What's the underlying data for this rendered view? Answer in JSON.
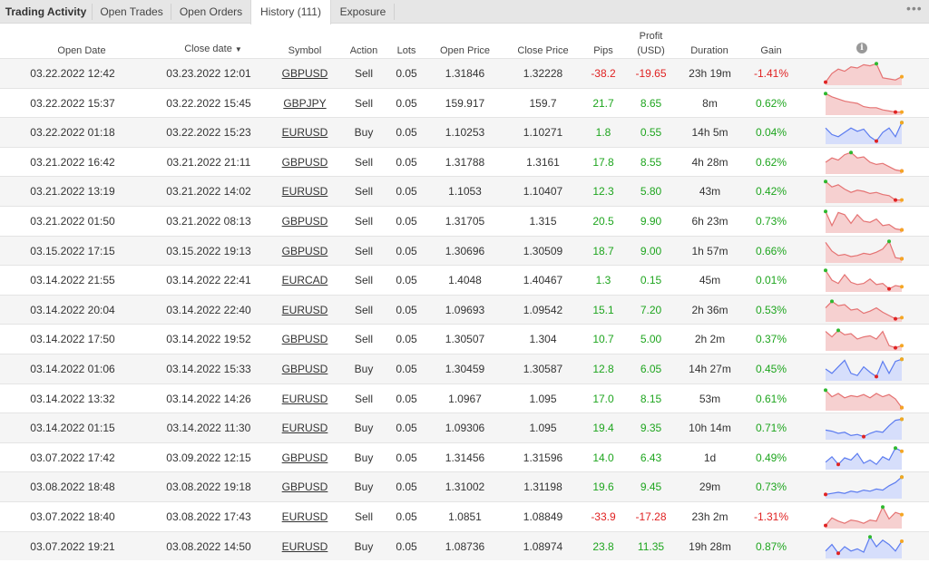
{
  "tabs": [
    {
      "label": "Trading Activity",
      "left": 0
    },
    {
      "label": "Open Trades"
    },
    {
      "label": "Open Orders"
    },
    {
      "label": "History (111)"
    },
    {
      "label": "Exposure"
    }
  ],
  "active_tab": "History (111)",
  "headers": {
    "open_date": "Open Date",
    "close_date": "Close date",
    "symbol": "Symbol",
    "action": "Action",
    "lots": "Lots",
    "open_price": "Open Price",
    "close_price": "Close Price",
    "pips": "Pips",
    "profit_line1": "Profit",
    "profit_line2": "(USD)",
    "duration": "Duration",
    "gain": "Gain"
  },
  "colors": {
    "positive": "#1ea51e",
    "negative": "#e02222",
    "sell_line": "#e57373",
    "sell_fill": "#f6d0d0",
    "buy_line": "#5c7cf0",
    "buy_fill": "#d6defb"
  },
  "icons": {
    "more": "more-dots-icon",
    "info": "info-icon"
  },
  "trades": [
    {
      "open_date": "03.22.2022 12:42",
      "close_date": "03.23.2022 12:01",
      "symbol": "GBPUSD",
      "action": "Sell",
      "lots": "0.05",
      "open_price": "1.31846",
      "close_price": "1.32228",
      "pips": "-38.2",
      "profit": "-19.65",
      "duration": "23h 19m",
      "gain": "-1.41%",
      "spark": [
        0.1,
        0.5,
        0.7,
        0.6,
        0.8,
        0.75,
        0.9,
        0.85,
        0.95,
        0.3,
        0.25,
        0.2,
        0.35
      ]
    },
    {
      "open_date": "03.22.2022 15:37",
      "close_date": "03.22.2022 15:45",
      "symbol": "GBPJPY",
      "action": "Sell",
      "lots": "0.05",
      "open_price": "159.917",
      "close_price": "159.7",
      "pips": "21.7",
      "profit": "8.65",
      "duration": "8m",
      "gain": "0.62%",
      "spark": [
        0.95,
        0.8,
        0.7,
        0.6,
        0.55,
        0.5,
        0.35,
        0.3,
        0.3,
        0.2,
        0.15,
        0.1,
        0.1
      ]
    },
    {
      "open_date": "03.22.2022 01:18",
      "close_date": "03.22.2022 15:23",
      "symbol": "EURUSD",
      "action": "Buy",
      "lots": "0.05",
      "open_price": "1.10253",
      "close_price": "1.10271",
      "pips": "1.8",
      "profit": "0.55",
      "duration": "14h 5m",
      "gain": "0.04%",
      "spark": [
        0.7,
        0.4,
        0.3,
        0.5,
        0.7,
        0.55,
        0.65,
        0.3,
        0.1,
        0.5,
        0.7,
        0.3,
        0.95
      ]
    },
    {
      "open_date": "03.21.2022 16:42",
      "close_date": "03.21.2022 21:11",
      "symbol": "GBPUSD",
      "action": "Sell",
      "lots": "0.05",
      "open_price": "1.31788",
      "close_price": "1.3161",
      "pips": "17.8",
      "profit": "8.55",
      "duration": "4h 28m",
      "gain": "0.62%",
      "spark": [
        0.5,
        0.7,
        0.6,
        0.85,
        0.95,
        0.7,
        0.75,
        0.5,
        0.4,
        0.45,
        0.3,
        0.15,
        0.1
      ]
    },
    {
      "open_date": "03.21.2022 13:19",
      "close_date": "03.21.2022 14:02",
      "symbol": "EURUSD",
      "action": "Sell",
      "lots": "0.05",
      "open_price": "1.1053",
      "close_price": "1.10407",
      "pips": "12.3",
      "profit": "5.80",
      "duration": "43m",
      "gain": "0.42%",
      "spark": [
        0.95,
        0.7,
        0.8,
        0.6,
        0.45,
        0.55,
        0.5,
        0.4,
        0.45,
        0.35,
        0.3,
        0.1,
        0.1
      ]
    },
    {
      "open_date": "03.21.2022 01:50",
      "close_date": "03.21.2022 08:13",
      "symbol": "GBPUSD",
      "action": "Sell",
      "lots": "0.05",
      "open_price": "1.31705",
      "close_price": "1.315",
      "pips": "20.5",
      "profit": "9.90",
      "duration": "6h 23m",
      "gain": "0.73%",
      "spark": [
        0.95,
        0.3,
        0.9,
        0.8,
        0.4,
        0.8,
        0.5,
        0.45,
        0.6,
        0.3,
        0.35,
        0.15,
        0.1
      ]
    },
    {
      "open_date": "03.15.2022 17:15",
      "close_date": "03.15.2022 19:13",
      "symbol": "GBPUSD",
      "action": "Sell",
      "lots": "0.05",
      "open_price": "1.30696",
      "close_price": "1.30509",
      "pips": "18.7",
      "profit": "9.00",
      "duration": "1h 57m",
      "gain": "0.66%",
      "spark": [
        0.9,
        0.5,
        0.3,
        0.35,
        0.25,
        0.3,
        0.4,
        0.35,
        0.45,
        0.6,
        0.95,
        0.2,
        0.15
      ]
    },
    {
      "open_date": "03.14.2022 21:55",
      "close_date": "03.14.2022 22:41",
      "symbol": "EURCAD",
      "action": "Sell",
      "lots": "0.05",
      "open_price": "1.4048",
      "close_price": "1.40467",
      "pips": "1.3",
      "profit": "0.15",
      "duration": "45m",
      "gain": "0.01%",
      "spark": [
        0.95,
        0.5,
        0.35,
        0.75,
        0.4,
        0.3,
        0.35,
        0.55,
        0.3,
        0.35,
        0.1,
        0.25,
        0.2
      ]
    },
    {
      "open_date": "03.14.2022 20:04",
      "close_date": "03.14.2022 22:40",
      "symbol": "EURUSD",
      "action": "Sell",
      "lots": "0.05",
      "open_price": "1.09693",
      "close_price": "1.09542",
      "pips": "15.1",
      "profit": "7.20",
      "duration": "2h 36m",
      "gain": "0.53%",
      "spark": [
        0.6,
        0.9,
        0.7,
        0.75,
        0.5,
        0.55,
        0.35,
        0.45,
        0.6,
        0.4,
        0.25,
        0.1,
        0.15
      ]
    },
    {
      "open_date": "03.14.2022 17:50",
      "close_date": "03.14.2022 19:52",
      "symbol": "GBPUSD",
      "action": "Sell",
      "lots": "0.05",
      "open_price": "1.30507",
      "close_price": "1.304",
      "pips": "10.7",
      "profit": "5.00",
      "duration": "2h 2m",
      "gain": "0.37%",
      "spark": [
        0.85,
        0.6,
        0.9,
        0.7,
        0.75,
        0.5,
        0.6,
        0.65,
        0.5,
        0.85,
        0.2,
        0.1,
        0.2
      ]
    },
    {
      "open_date": "03.14.2022 01:06",
      "close_date": "03.14.2022 15:33",
      "symbol": "GBPUSD",
      "action": "Buy",
      "lots": "0.05",
      "open_price": "1.30459",
      "close_price": "1.30587",
      "pips": "12.8",
      "profit": "6.05",
      "duration": "14h 27m",
      "gain": "0.45%",
      "spark": [
        0.5,
        0.3,
        0.6,
        0.9,
        0.3,
        0.2,
        0.6,
        0.35,
        0.15,
        0.85,
        0.3,
        0.85,
        0.95
      ]
    },
    {
      "open_date": "03.14.2022 13:32",
      "close_date": "03.14.2022 14:26",
      "symbol": "EURUSD",
      "action": "Sell",
      "lots": "0.05",
      "open_price": "1.0967",
      "close_price": "1.095",
      "pips": "17.0",
      "profit": "8.15",
      "duration": "53m",
      "gain": "0.61%",
      "spark": [
        0.9,
        0.6,
        0.75,
        0.55,
        0.65,
        0.6,
        0.7,
        0.55,
        0.75,
        0.6,
        0.7,
        0.5,
        0.1
      ]
    },
    {
      "open_date": "03.14.2022 01:15",
      "close_date": "03.14.2022 11:30",
      "symbol": "EURUSD",
      "action": "Buy",
      "lots": "0.05",
      "open_price": "1.09306",
      "close_price": "1.095",
      "pips": "19.4",
      "profit": "9.35",
      "duration": "10h 14m",
      "gain": "0.71%",
      "spark": [
        0.4,
        0.35,
        0.25,
        0.3,
        0.15,
        0.2,
        0.1,
        0.25,
        0.35,
        0.3,
        0.6,
        0.85,
        0.9
      ]
    },
    {
      "open_date": "03.07.2022 17:42",
      "close_date": "03.09.2022 12:15",
      "symbol": "GBPUSD",
      "action": "Buy",
      "lots": "0.05",
      "open_price": "1.31456",
      "close_price": "1.31596",
      "pips": "14.0",
      "profit": "6.43",
      "duration": "1d",
      "gain": "0.49%",
      "spark": [
        0.3,
        0.55,
        0.2,
        0.5,
        0.4,
        0.7,
        0.25,
        0.4,
        0.2,
        0.55,
        0.4,
        0.95,
        0.8
      ]
    },
    {
      "open_date": "03.08.2022 18:48",
      "close_date": "03.08.2022 19:18",
      "symbol": "GBPUSD",
      "action": "Buy",
      "lots": "0.05",
      "open_price": "1.31002",
      "close_price": "1.31198",
      "pips": "19.6",
      "profit": "9.45",
      "duration": "29m",
      "gain": "0.73%",
      "spark": [
        0.15,
        0.2,
        0.25,
        0.2,
        0.3,
        0.25,
        0.35,
        0.3,
        0.4,
        0.35,
        0.55,
        0.7,
        0.95
      ]
    },
    {
      "open_date": "03.07.2022 18:40",
      "close_date": "03.08.2022 17:43",
      "symbol": "EURUSD",
      "action": "Sell",
      "lots": "0.05",
      "open_price": "1.0851",
      "close_price": "1.08849",
      "pips": "-33.9",
      "profit": "-17.28",
      "duration": "23h 2m",
      "gain": "-1.31%",
      "spark": [
        0.1,
        0.45,
        0.3,
        0.2,
        0.35,
        0.3,
        0.2,
        0.35,
        0.3,
        0.95,
        0.4,
        0.7,
        0.6
      ]
    },
    {
      "open_date": "03.07.2022 19:21",
      "close_date": "03.08.2022 14:50",
      "symbol": "EURUSD",
      "action": "Buy",
      "lots": "0.05",
      "open_price": "1.08736",
      "close_price": "1.08974",
      "pips": "23.8",
      "profit": "11.35",
      "duration": "19h 28m",
      "gain": "0.87%",
      "spark": [
        0.3,
        0.6,
        0.2,
        0.5,
        0.3,
        0.4,
        0.25,
        0.95,
        0.5,
        0.8,
        0.6,
        0.3,
        0.75
      ]
    }
  ]
}
